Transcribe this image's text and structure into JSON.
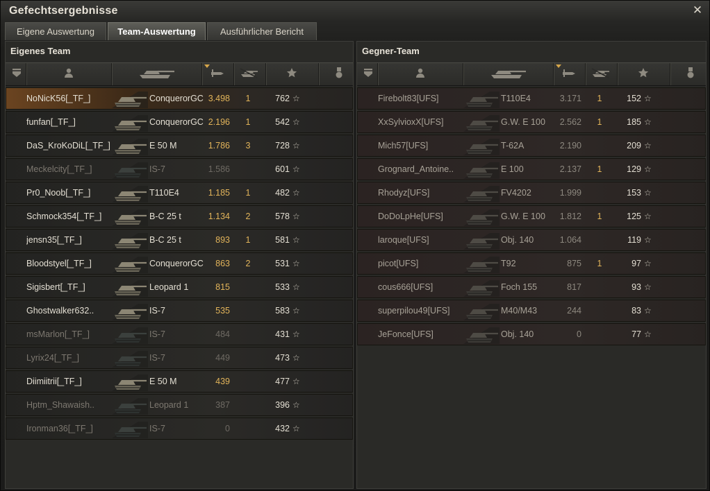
{
  "window": {
    "title": "Gefechtsergebnisse",
    "close_glyph": "✕"
  },
  "tabs": [
    {
      "label": "Eigene Auswertung",
      "active": false
    },
    {
      "label": "Team-Auswertung",
      "active": true
    },
    {
      "label": "Ausführlicher Bericht",
      "active": false
    }
  ],
  "header_icons": [
    "shield-icon",
    "player-icon",
    "tank-icon",
    "damage-icon",
    "kills-icon",
    "xp-star-icon",
    "medal-icon"
  ],
  "sort_column": "damage",
  "own_team": {
    "title": "Eigenes Team",
    "rows": [
      {
        "player": "NoNicK56[_TF_]",
        "tank": "ConquerorGC",
        "damage": "3.498",
        "kills": "1",
        "xp": "762",
        "alive": true,
        "me": true
      },
      {
        "player": "funfan[_TF_]",
        "tank": "ConquerorGC",
        "damage": "2.196",
        "kills": "1",
        "xp": "542",
        "alive": true
      },
      {
        "player": "DaS_KroKoDiL[_TF_]",
        "tank": "E 50 M",
        "damage": "1.786",
        "kills": "3",
        "xp": "728",
        "alive": true
      },
      {
        "player": "Meckelcity[_TF_]",
        "tank": "IS-7",
        "damage": "1.586",
        "kills": "",
        "xp": "601",
        "alive": false
      },
      {
        "player": "Pr0_Noob[_TF_]",
        "tank": "T110E4",
        "damage": "1.185",
        "kills": "1",
        "xp": "482",
        "alive": true
      },
      {
        "player": "Schmock354[_TF_]",
        "tank": "B-C 25 t",
        "damage": "1.134",
        "kills": "2",
        "xp": "578",
        "alive": true
      },
      {
        "player": "jensn35[_TF_]",
        "tank": "B-C 25 t",
        "damage": "893",
        "kills": "1",
        "xp": "581",
        "alive": true
      },
      {
        "player": "Bloodstyel[_TF_]",
        "tank": "ConquerorGC",
        "damage": "863",
        "kills": "2",
        "xp": "531",
        "alive": true
      },
      {
        "player": "Sigisbert[_TF_]",
        "tank": "Leopard 1",
        "damage": "815",
        "kills": "",
        "xp": "533",
        "alive": true
      },
      {
        "player": "Ghostwalker632..",
        "tank": "IS-7",
        "damage": "535",
        "kills": "",
        "xp": "583",
        "alive": true
      },
      {
        "player": "msMarlon[_TF_]",
        "tank": "IS-7",
        "damage": "484",
        "kills": "",
        "xp": "431",
        "alive": false
      },
      {
        "player": "Lyrix24[_TF_]",
        "tank": "IS-7",
        "damage": "449",
        "kills": "",
        "xp": "473",
        "alive": false
      },
      {
        "player": "Diimiitrii[_TF_]",
        "tank": "E 50 M",
        "damage": "439",
        "kills": "",
        "xp": "477",
        "alive": true
      },
      {
        "player": "Hptm_Shawaish..",
        "tank": "Leopard 1",
        "damage": "387",
        "kills": "",
        "xp": "396",
        "alive": false
      },
      {
        "player": "Ironman36[_TF_]",
        "tank": "IS-7",
        "damage": "0",
        "kills": "",
        "xp": "432",
        "alive": false
      }
    ]
  },
  "enemy_team": {
    "title": "Gegner-Team",
    "rows": [
      {
        "player": "Firebolt83[UFS]",
        "tank": "T110E4",
        "damage": "3.171",
        "kills": "1",
        "xp": "152"
      },
      {
        "player": "XxSylvioxX[UFS]",
        "tank": "G.W. E 100",
        "damage": "2.562",
        "kills": "1",
        "xp": "185"
      },
      {
        "player": "Mich57[UFS]",
        "tank": "T-62A",
        "damage": "2.190",
        "kills": "",
        "xp": "209"
      },
      {
        "player": "Grognard_Antoine..",
        "tank": "E 100",
        "damage": "2.137",
        "kills": "1",
        "xp": "129"
      },
      {
        "player": "Rhodyz[UFS]",
        "tank": "FV4202",
        "damage": "1.999",
        "kills": "",
        "xp": "153"
      },
      {
        "player": "DoDoLpHe[UFS]",
        "tank": "G.W. E 100",
        "damage": "1.812",
        "kills": "1",
        "xp": "125"
      },
      {
        "player": "laroque[UFS]",
        "tank": "Obj. 140",
        "damage": "1.064",
        "kills": "",
        "xp": "119"
      },
      {
        "player": "picot[UFS]",
        "tank": "T92",
        "damage": "875",
        "kills": "1",
        "xp": "97"
      },
      {
        "player": "cous666[UFS]",
        "tank": "Foch 155",
        "damage": "817",
        "kills": "",
        "xp": "93"
      },
      {
        "player": "superpilou49[UFS]",
        "tank": "M40/M43",
        "damage": "244",
        "kills": "",
        "xp": "83"
      },
      {
        "player": "JeFonce[UFS]",
        "tank": "Obj. 140",
        "damage": "0",
        "kills": "",
        "xp": "77"
      }
    ]
  },
  "star_glyph": "☆",
  "colors": {
    "damage": "#e2b45a",
    "highlight": "#6b4420",
    "dead_text": "#7d7870"
  }
}
